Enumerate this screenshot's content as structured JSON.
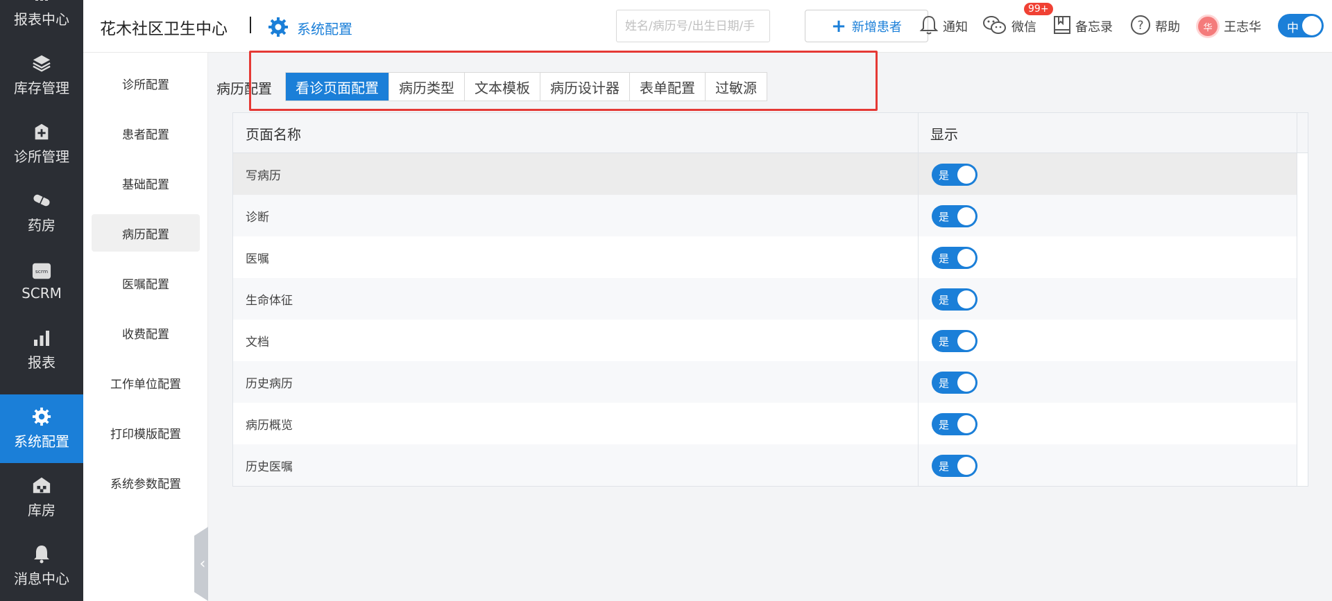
{
  "left_nav": {
    "items": [
      {
        "label": "报表中心",
        "icon": "chart-icon"
      },
      {
        "label": "库存管理",
        "icon": "layers-icon"
      },
      {
        "label": "诊所管理",
        "icon": "medical-plus-icon"
      },
      {
        "label": "药房",
        "icon": "pill-icon"
      },
      {
        "label": "SCRM",
        "icon": "scrm-icon"
      },
      {
        "label": "报表",
        "icon": "bar-chart-icon"
      },
      {
        "label": "系统配置",
        "icon": "gear-icon"
      },
      {
        "label": "库房",
        "icon": "warehouse-icon"
      },
      {
        "label": "消息中心",
        "icon": "bell-icon"
      }
    ],
    "active_label": "系统配置"
  },
  "header": {
    "clinic_name": "花木社区卫生中心",
    "section": "系统配置",
    "search_placeholder": "姓名/病历号/出生日期/手",
    "add_patient_label": "新增患者",
    "notify_label": "通知",
    "notify_badge": "99+",
    "wechat_label": "微信",
    "memo_label": "备忘录",
    "help_label": "帮助",
    "user_name": "王志华",
    "avatar_text": "华",
    "lang_label": "中"
  },
  "sub_nav": {
    "items": [
      "诊所配置",
      "患者配置",
      "基础配置",
      "病历配置",
      "医嘱配置",
      "收费配置",
      "工作单位配置",
      "打印模版配置",
      "系统参数配置"
    ],
    "active": "病历配置"
  },
  "breadcrumb": "病历配置",
  "tabs": {
    "items": [
      "看诊页面配置",
      "病历类型",
      "文本模板",
      "病历设计器",
      "表单配置",
      "过敏源"
    ],
    "active": "看诊页面配置"
  },
  "table": {
    "headers": [
      "页面名称",
      "显示"
    ],
    "rows": [
      {
        "name": "写病历",
        "show": "是",
        "on": true
      },
      {
        "name": "诊断",
        "show": "是",
        "on": true
      },
      {
        "name": "医嘱",
        "show": "是",
        "on": true
      },
      {
        "name": "生命体征",
        "show": "是",
        "on": true
      },
      {
        "name": "文档",
        "show": "是",
        "on": true
      },
      {
        "name": "历史病历",
        "show": "是",
        "on": true
      },
      {
        "name": "病历概览",
        "show": "是",
        "on": true
      },
      {
        "name": "历史医嘱",
        "show": "是",
        "on": true
      }
    ]
  },
  "colors": {
    "accent": "#1b7fd8",
    "highlight": "#e53935",
    "nav_bg": "#2b2e34"
  }
}
